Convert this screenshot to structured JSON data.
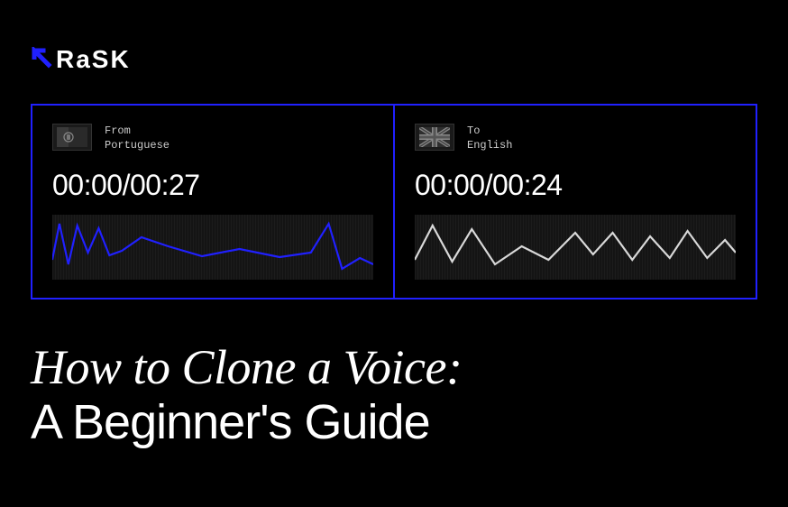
{
  "logo": {
    "brand_text": "RaSK",
    "arrow_name": "logo-arrow-icon"
  },
  "panels": {
    "left": {
      "direction_label": "From",
      "language": "Portuguese",
      "time": "00:00/00:27",
      "flag_name": "portugal-flag-icon",
      "wave_color": "#2020ff"
    },
    "right": {
      "direction_label": "To",
      "language": "English",
      "time": "00:00/00:24",
      "flag_name": "uk-flag-icon",
      "wave_color": "#d9d9d9"
    }
  },
  "title": {
    "line1": "How to Clone a Voice:",
    "line2": "A Beginner's Guide"
  }
}
